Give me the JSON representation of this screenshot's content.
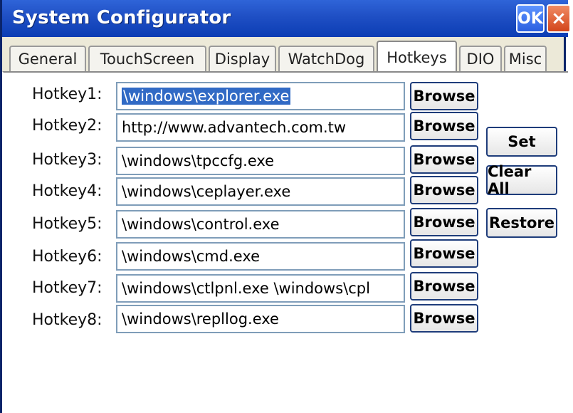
{
  "window": {
    "title": "System Configurator",
    "ok_label": "OK",
    "close_label": "×"
  },
  "tabs": [
    {
      "label": "General"
    },
    {
      "label": "TouchScreen"
    },
    {
      "label": "Display"
    },
    {
      "label": "WatchDog"
    },
    {
      "label": "Hotkeys"
    },
    {
      "label": "DIO"
    },
    {
      "label": "Misc"
    }
  ],
  "active_tab": "Hotkeys",
  "hotkeys": [
    {
      "label": "Hotkey1:",
      "value": "\\windows\\explorer.exe",
      "selected": true
    },
    {
      "label": "Hotkey2:",
      "value": "http://www.advantech.com.tw"
    },
    {
      "label": "Hotkey3:",
      "value": "\\windows\\tpccfg.exe"
    },
    {
      "label": "Hotkey4:",
      "value": "\\windows\\ceplayer.exe"
    },
    {
      "label": "Hotkey5:",
      "value": "\\windows\\control.exe"
    },
    {
      "label": "Hotkey6:",
      "value": "\\windows\\cmd.exe"
    },
    {
      "label": "Hotkey7:",
      "value": "\\windows\\ctlpnl.exe \\windows\\cpl"
    },
    {
      "label": "Hotkey8:",
      "value": "\\windows\\repllog.exe"
    }
  ],
  "browse_label": "Browse",
  "side_buttons": {
    "set": "Set",
    "clear_all": "Clear All",
    "restore": "Restore"
  },
  "colors": {
    "titlebar": "#0b3db4",
    "selection": "#316ac5",
    "close": "#d3461b"
  }
}
